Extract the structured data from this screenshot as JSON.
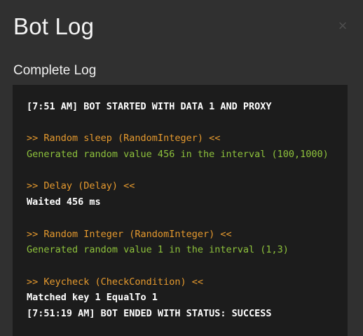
{
  "modal": {
    "title": "Bot Log",
    "close_glyph": "×",
    "close_icon": "close-icon",
    "section_heading": "Complete Log"
  },
  "colors": {
    "background": "#303030",
    "log_background": "#1c1c1c",
    "info": "#ffffff",
    "block_header": "#e69a2e",
    "success": "#8ec23c"
  },
  "log": {
    "lines": [
      {
        "kind": "info",
        "text": "[7:51 AM] BOT STARTED WITH DATA 1 AND PROXY"
      },
      {
        "kind": "blank",
        "text": ""
      },
      {
        "kind": "block",
        "text": ">> Random sleep (RandomInteger) <<"
      },
      {
        "kind": "success",
        "text": "Generated random value 456 in the interval (100,1000)"
      },
      {
        "kind": "blank",
        "text": ""
      },
      {
        "kind": "block",
        "text": ">> Delay (Delay) <<"
      },
      {
        "kind": "info",
        "text": "Waited 456 ms"
      },
      {
        "kind": "blank",
        "text": ""
      },
      {
        "kind": "block",
        "text": ">> Random Integer (RandomInteger) <<"
      },
      {
        "kind": "success",
        "text": "Generated random value 1 in the interval (1,3)"
      },
      {
        "kind": "blank",
        "text": ""
      },
      {
        "kind": "block",
        "text": ">> Keycheck (CheckCondition) <<"
      },
      {
        "kind": "info",
        "text": "Matched key 1 EqualTo 1"
      },
      {
        "kind": "info",
        "text": "[7:51:19 AM] BOT ENDED WITH STATUS: SUCCESS"
      }
    ]
  }
}
